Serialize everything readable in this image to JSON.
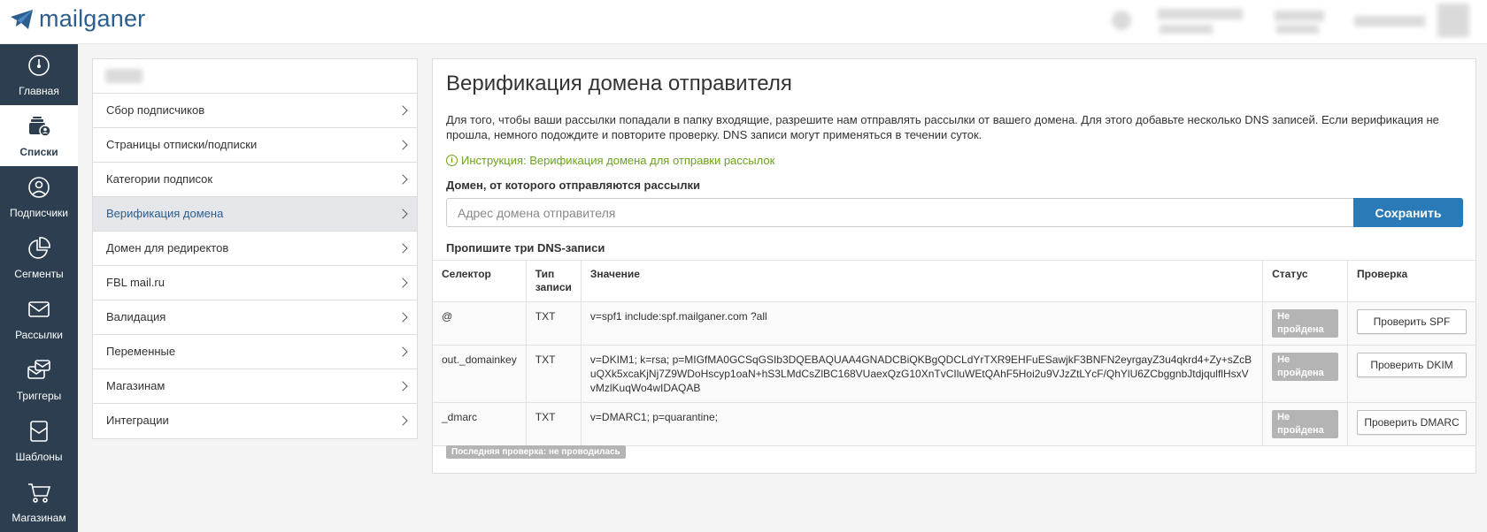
{
  "app": {
    "logo_text": "mailganer"
  },
  "sidebar": {
    "items": [
      {
        "label": "Главная",
        "icon": "dashboard-gauge-icon"
      },
      {
        "label": "Списки",
        "icon": "lists-icon"
      },
      {
        "label": "Подписчики",
        "icon": "user-icon"
      },
      {
        "label": "Сегменты",
        "icon": "pie-chart-icon"
      },
      {
        "label": "Рассылки",
        "icon": "envelope-icon"
      },
      {
        "label": "Триггеры",
        "icon": "trigger-icon"
      },
      {
        "label": "Шаблоны",
        "icon": "template-icon"
      },
      {
        "label": "Магазинам",
        "icon": "cart-icon"
      }
    ],
    "active_index": 1
  },
  "submenu": {
    "items": [
      "Сбор подписчиков",
      "Страницы отписки/подписки",
      "Категории подписок",
      "Верификация домена",
      "Домен для редиректов",
      "FBL mail.ru",
      "Валидация",
      "Переменные",
      "Магазинам",
      "Интеграции"
    ],
    "active_index": 3
  },
  "main": {
    "title": "Верификация домена отправителя",
    "description": "Для того, чтобы ваши рассылки попадали в папку входящие, разрешите нам отправлять рассылки от вашего домена. Для этого добавьте несколько DNS записей. Если верификация не прошла, немного подождите и повторите проверку. DNS записи могут применяться в течении суток.",
    "instruction_link": "Инструкция: Верификация домена для отправки рассылок",
    "domain_label": "Домен, от которого отправляются рассылки",
    "domain_placeholder": "Адрес домена отправителя",
    "domain_value": "",
    "save_label": "Сохранить",
    "dns_title": "Пропишите три DNS-записи",
    "table": {
      "headers": [
        "Селектор",
        "Тип записи",
        "Значение",
        "Статус",
        "Проверка"
      ],
      "rows": [
        {
          "selector": "@",
          "type": "TXT",
          "value": "v=spf1 include:spf.mailganer.com ?all",
          "status": "Не пройдена",
          "action": "Проверить SPF"
        },
        {
          "selector": "out._domainkey",
          "type": "TXT",
          "value": "v=DKIM1; k=rsa; p=MIGfMA0GCSqGSIb3DQEBAQUAA4GNADCBiQKBgQDCLdYrTXR9EHFuESawjkF3BNFN2eyrgayZ3u4qkrd4+Zy+sZcBuQXk5xcaKjNj7Z9WDoHscyp1oaN+hS3LMdCsZlBC168VUaexQzG10XnTvCIluWEtQAhF5Hoi2u9VJzZtLYcF/QhYlU6ZCbggnbJtdjqulflHsxVvMzlKuqWo4wIDAQAB",
          "status": "Не пройдена",
          "action": "Проверить DKIM"
        },
        {
          "selector": "_dmarc",
          "type": "TXT",
          "value": "v=DMARC1; p=quarantine;",
          "status": "Не пройдена",
          "action": "Проверить DMARC"
        }
      ]
    },
    "last_check": "Последняя проверка: не проводилась"
  },
  "colors": {
    "sidebar_bg": "#2c3e50",
    "accent": "#2a7ab8",
    "instruction": "#6aa31c",
    "badge": "#b4b4b4"
  }
}
